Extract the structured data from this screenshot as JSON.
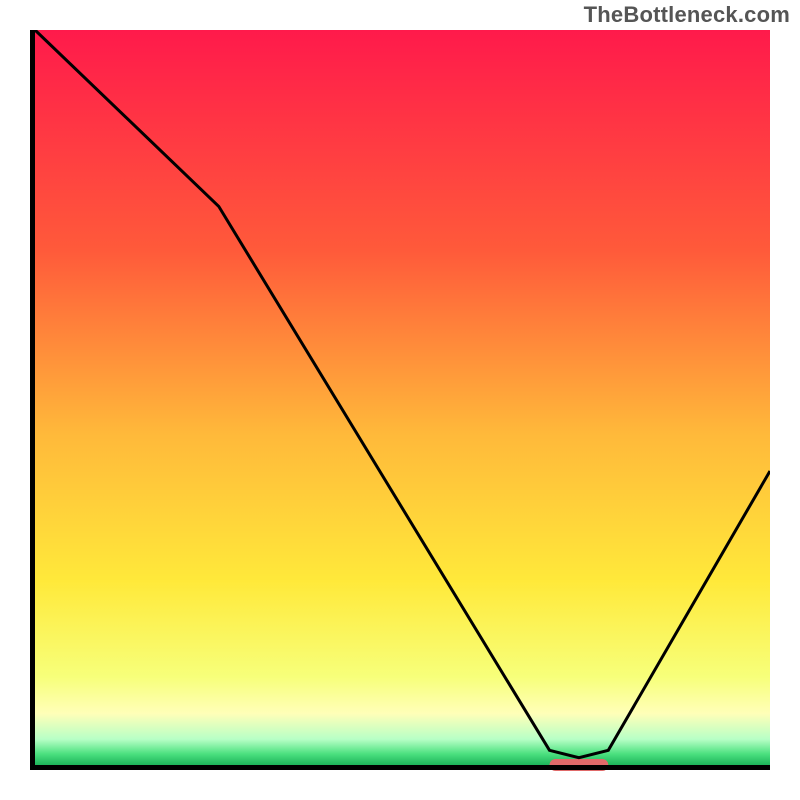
{
  "watermark": "TheBottleneck.com",
  "chart_data": {
    "type": "line",
    "title": "",
    "xlabel": "",
    "ylabel": "",
    "xlim": [
      0,
      100
    ],
    "ylim": [
      0,
      100
    ],
    "x": [
      0,
      25,
      70,
      74,
      78,
      100
    ],
    "y": [
      100,
      76,
      2,
      1,
      2,
      40
    ],
    "optimal_marker": {
      "x_start": 70,
      "x_end": 78,
      "y": 0
    },
    "gradient_stops": [
      {
        "offset": 0.0,
        "color": "#ff1a4b"
      },
      {
        "offset": 0.3,
        "color": "#ff5a3a"
      },
      {
        "offset": 0.55,
        "color": "#ffb93a"
      },
      {
        "offset": 0.75,
        "color": "#ffe93a"
      },
      {
        "offset": 0.88,
        "color": "#f7ff7a"
      },
      {
        "offset": 0.93,
        "color": "#ffffb8"
      },
      {
        "offset": 0.965,
        "color": "#b7ffc6"
      },
      {
        "offset": 0.985,
        "color": "#4be07f"
      },
      {
        "offset": 1.0,
        "color": "#1db55a"
      }
    ]
  }
}
